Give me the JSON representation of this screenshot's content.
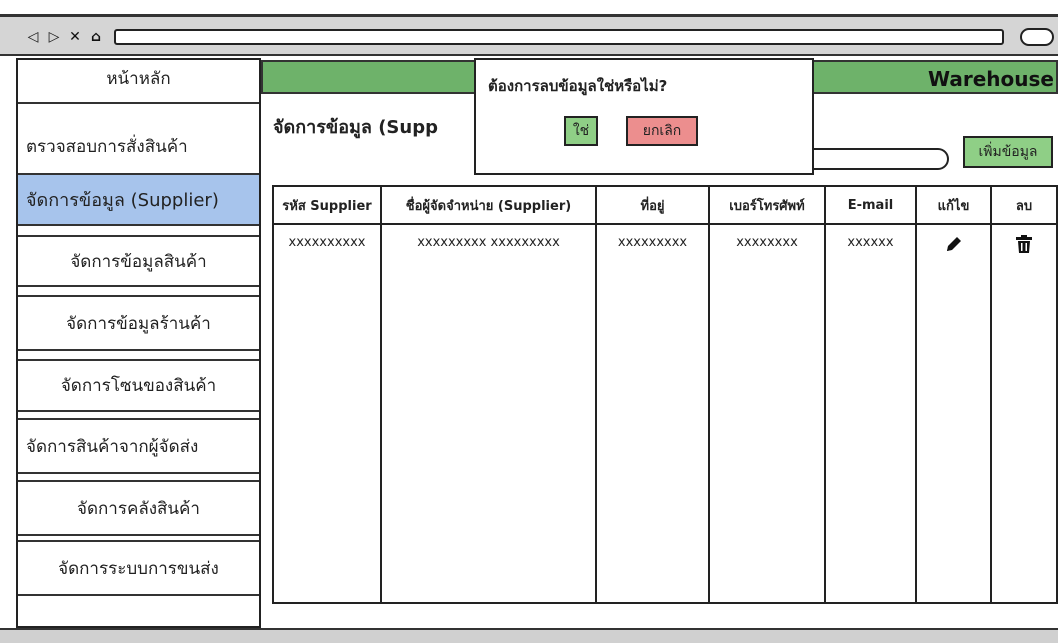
{
  "browser": {
    "nav_icons": [
      "◁",
      "▷",
      "✕",
      "⌂"
    ]
  },
  "sidebar": {
    "home": "หน้าหลัก",
    "items": [
      {
        "label": "ตรวจสอบการสั่งสินค้า"
      },
      {
        "label": "จัดการข้อมูล (Supplier)",
        "active": true
      },
      {
        "label": "จัดการข้อมูลสินค้า"
      },
      {
        "label": "จัดการข้อมูลร้านค้า"
      },
      {
        "label": "จัดการโซนของสินค้า"
      },
      {
        "label": "จัดการสินค้าจากผู้จัดส่ง"
      },
      {
        "label": "จัดการคลังสินค้า"
      },
      {
        "label": "จัดการระบบการขนส่ง"
      }
    ]
  },
  "header": {
    "brand": "Warehouse",
    "color": "#6eb26a"
  },
  "main": {
    "title": "จัดการข้อมูล (Supp",
    "add_button": "เพิ่มข้อมูล"
  },
  "table": {
    "columns": [
      "รหัส Supplier",
      "ชื่อผู้จัดจำหน่าย (Supplier)",
      "ที่อยู่",
      "เบอร์โทรศัพท์",
      "E-mail",
      "แก้ไข",
      "ลบ"
    ],
    "rows": [
      {
        "id": "xxxxxxxxxx",
        "name": "xxxxxxxxx xxxxxxxxx",
        "address": "xxxxxxxxx",
        "phone": "xxxxxxxx",
        "email": "xxxxxx",
        "edit_icon": "pencil-icon",
        "delete_icon": "trash-icon"
      }
    ]
  },
  "modal": {
    "question": "ต้องการลบข้อมูลใช่หรือไม่?",
    "yes": "ใช่",
    "cancel": "ยกเลิก"
  },
  "colors": {
    "active_sidebar": "#a7c4ec",
    "confirm_button": "#8fcf86",
    "cancel_button": "#ec8e8e"
  }
}
